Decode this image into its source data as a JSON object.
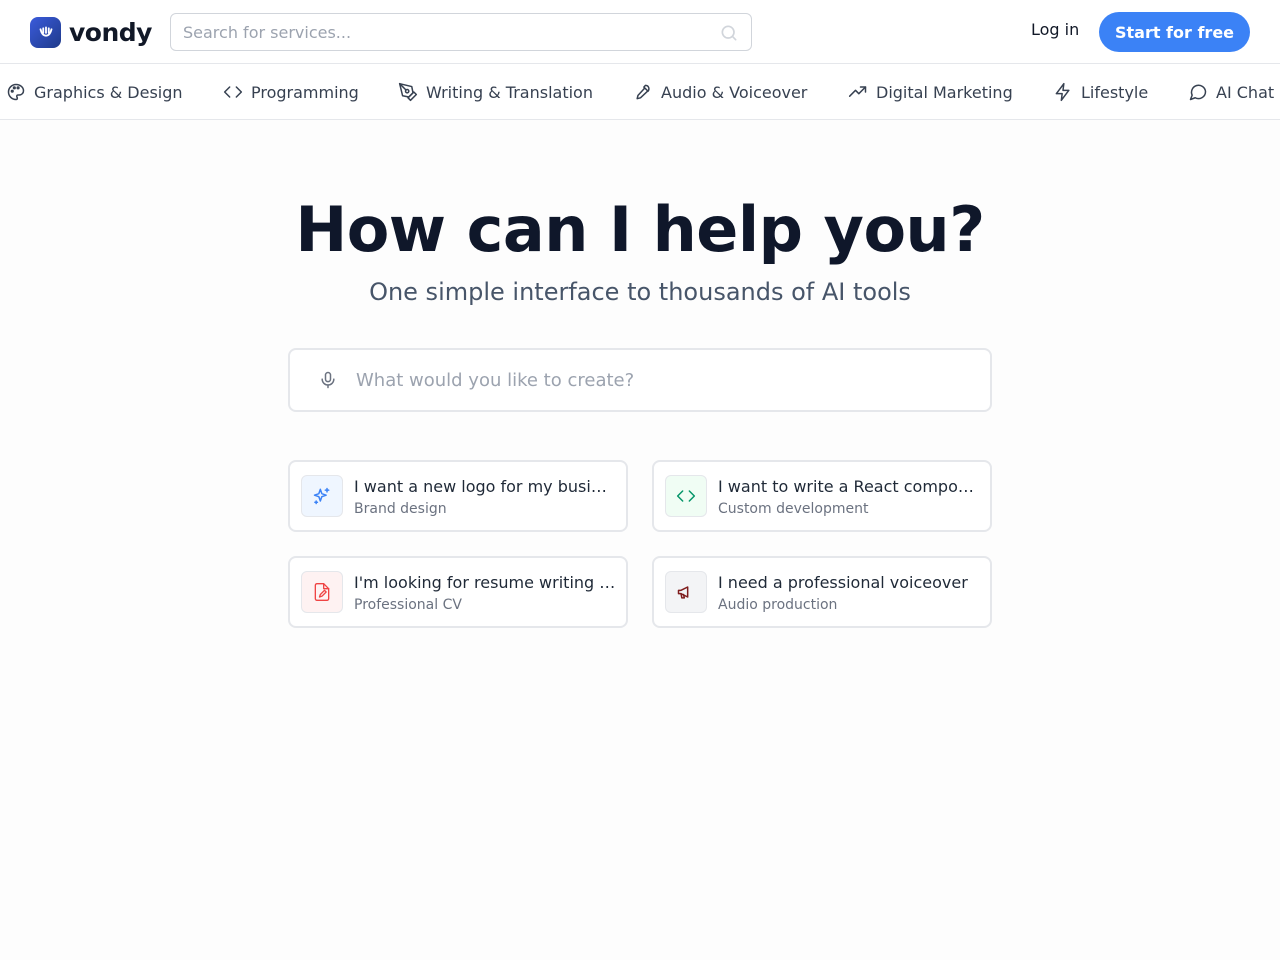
{
  "brand": {
    "name": "vondy",
    "accent_color": "#3b82f6",
    "logo_color": "#2f4fc7"
  },
  "header": {
    "search_placeholder": "Search for services...",
    "search_icon": "search-icon",
    "login_label": "Log in",
    "start_label": "Start for free"
  },
  "categories": [
    {
      "label": "Graphics & Design",
      "icon": "palette-icon"
    },
    {
      "label": "Programming",
      "icon": "code-icon"
    },
    {
      "label": "Writing & Translation",
      "icon": "pen-tool-icon"
    },
    {
      "label": "Audio & Voiceover",
      "icon": "microphone-icon"
    },
    {
      "label": "Digital Marketing",
      "icon": "trending-up-icon"
    },
    {
      "label": "Lifestyle",
      "icon": "lightning-icon"
    },
    {
      "label": "AI Chat",
      "icon": "chat-bubble-icon"
    }
  ],
  "hero": {
    "title": "How can I help you?",
    "subtitle": "One simple interface to thousands of AI tools",
    "prompt_placeholder": "What would you like to create?",
    "mic_icon": "microphone-icon"
  },
  "suggestions": [
    {
      "title": "I want a new logo for my business",
      "subtitle": "Brand design",
      "icon": "sparkles-icon",
      "color": "#3b82f6",
      "bg": "#eff6ff"
    },
    {
      "title": "I want to write a React component",
      "subtitle": "Custom development",
      "icon": "code-icon",
      "color": "#059669",
      "bg": "#f0fdf4"
    },
    {
      "title": "I'm looking for resume writing help",
      "subtitle": "Professional CV",
      "icon": "file-edit-icon",
      "color": "#ef4444",
      "bg": "#fef2f2"
    },
    {
      "title": "I need a professional voiceover",
      "subtitle": "Audio production",
      "icon": "megaphone-icon",
      "color": "#7f1d1d",
      "bg": "#f3f4f6"
    }
  ]
}
